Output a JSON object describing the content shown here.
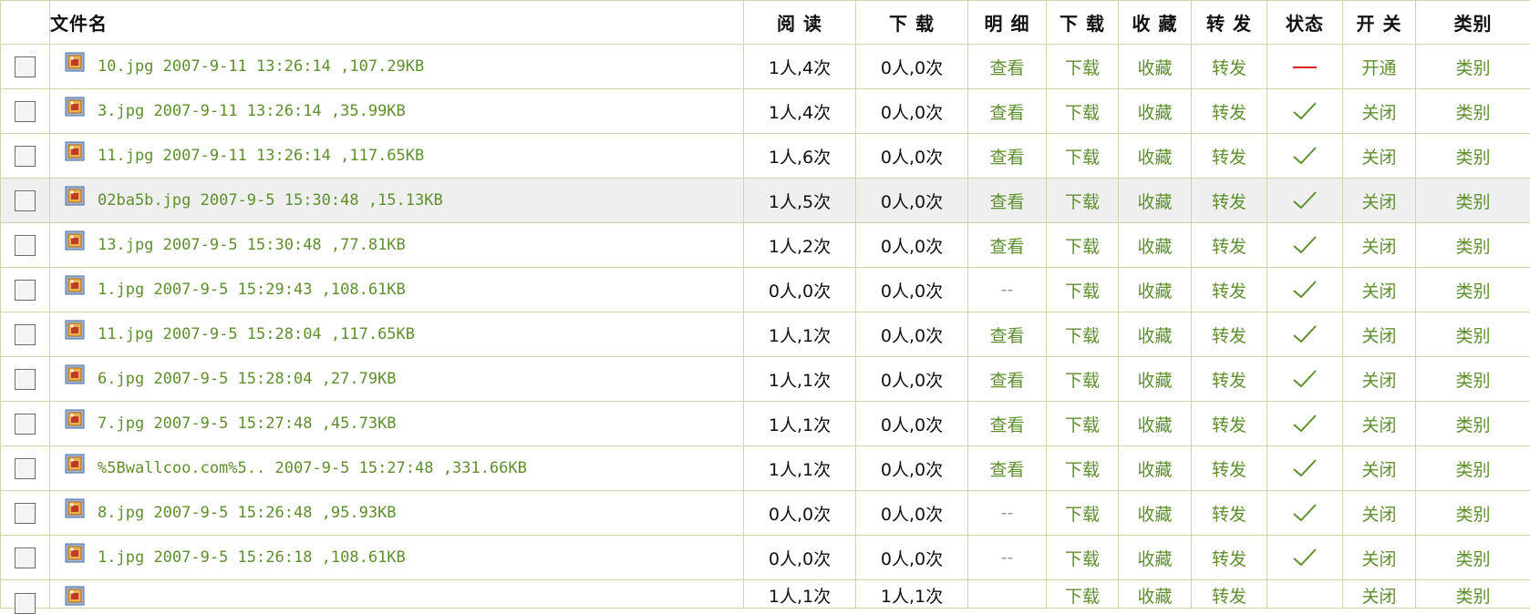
{
  "headers": {
    "filename": "文件名",
    "read": "阅 读",
    "download": "下 载",
    "detail": "明 细",
    "download2": "下 载",
    "favorite": "收 藏",
    "forward": "转 发",
    "status": "状态",
    "toggle": "开 关",
    "category": "类别"
  },
  "rows": [
    {
      "name": "10.jpg",
      "meta": "2007-9-11 13:26:14 ,107.29KB",
      "read": "1人,4次",
      "download": "0人,0次",
      "detail": "查看",
      "download_link": "下载",
      "favorite": "收藏",
      "forward": "转发",
      "status": "off",
      "toggle": "开通",
      "category": "类别"
    },
    {
      "name": "3.jpg",
      "meta": "2007-9-11 13:26:14 ,35.99KB",
      "read": "1人,4次",
      "download": "0人,0次",
      "detail": "查看",
      "download_link": "下载",
      "favorite": "收藏",
      "forward": "转发",
      "status": "on",
      "toggle": "关闭",
      "category": "类别"
    },
    {
      "name": "11.jpg",
      "meta": "2007-9-11 13:26:14 ,117.65KB",
      "read": "1人,6次",
      "download": "0人,0次",
      "detail": "查看",
      "download_link": "下载",
      "favorite": "收藏",
      "forward": "转发",
      "status": "on",
      "toggle": "关闭",
      "category": "类别"
    },
    {
      "name": "02ba5b.jpg",
      "meta": "2007-9-5 15:30:48 ,15.13KB",
      "read": "1人,5次",
      "download": "0人,0次",
      "detail": "查看",
      "download_link": "下载",
      "favorite": "收藏",
      "forward": "转发",
      "status": "on",
      "toggle": "关闭",
      "category": "类别"
    },
    {
      "name": "13.jpg",
      "meta": "2007-9-5 15:30:48 ,77.81KB",
      "read": "1人,2次",
      "download": "0人,0次",
      "detail": "查看",
      "download_link": "下载",
      "favorite": "收藏",
      "forward": "转发",
      "status": "on",
      "toggle": "关闭",
      "category": "类别"
    },
    {
      "name": "1.jpg",
      "meta": "2007-9-5 15:29:43 ,108.61KB",
      "read": "0人,0次",
      "download": "0人,0次",
      "detail": "--",
      "download_link": "下载",
      "favorite": "收藏",
      "forward": "转发",
      "status": "on",
      "toggle": "关闭",
      "category": "类别"
    },
    {
      "name": "11.jpg",
      "meta": "2007-9-5 15:28:04 ,117.65KB",
      "read": "1人,1次",
      "download": "0人,0次",
      "detail": "查看",
      "download_link": "下载",
      "favorite": "收藏",
      "forward": "转发",
      "status": "on",
      "toggle": "关闭",
      "category": "类别"
    },
    {
      "name": "6.jpg",
      "meta": "2007-9-5 15:28:04 ,27.79KB",
      "read": "1人,1次",
      "download": "0人,0次",
      "detail": "查看",
      "download_link": "下载",
      "favorite": "收藏",
      "forward": "转发",
      "status": "on",
      "toggle": "关闭",
      "category": "类别"
    },
    {
      "name": "7.jpg",
      "meta": "2007-9-5 15:27:48 ,45.73KB",
      "read": "1人,1次",
      "download": "0人,0次",
      "detail": "查看",
      "download_link": "下载",
      "favorite": "收藏",
      "forward": "转发",
      "status": "on",
      "toggle": "关闭",
      "category": "类别"
    },
    {
      "name": "%5Bwallcoo.com%5..",
      "meta": "2007-9-5 15:27:48 ,331.66KB",
      "read": "1人,1次",
      "download": "0人,0次",
      "detail": "查看",
      "download_link": "下载",
      "favorite": "收藏",
      "forward": "转发",
      "status": "on",
      "toggle": "关闭",
      "category": "类别"
    },
    {
      "name": "8.jpg",
      "meta": "2007-9-5 15:26:48 ,95.93KB",
      "read": "0人,0次",
      "download": "0人,0次",
      "detail": "--",
      "download_link": "下载",
      "favorite": "收藏",
      "forward": "转发",
      "status": "on",
      "toggle": "关闭",
      "category": "类别"
    },
    {
      "name": "1.jpg",
      "meta": "2007-9-5 15:26:18 ,108.61KB",
      "read": "0人,0次",
      "download": "0人,0次",
      "detail": "--",
      "download_link": "下载",
      "favorite": "收藏",
      "forward": "转发",
      "status": "on",
      "toggle": "关闭",
      "category": "类别"
    }
  ],
  "partial_row": {
    "read": "1人,1次",
    "download": "1人,1次",
    "download_link": "下载",
    "favorite": "收藏",
    "forward": "转发",
    "toggle": "关闭",
    "category": "类别"
  },
  "highlighted_row_index": 3,
  "colors": {
    "link": "#5e8f2e",
    "border": "#c8d8a8",
    "dash": "#e02020",
    "check": "#5e8f2e",
    "highlight": "#efefef"
  },
  "icons": {
    "file": "image-file-icon",
    "status_on": "check-icon",
    "status_off": "dash-icon"
  }
}
